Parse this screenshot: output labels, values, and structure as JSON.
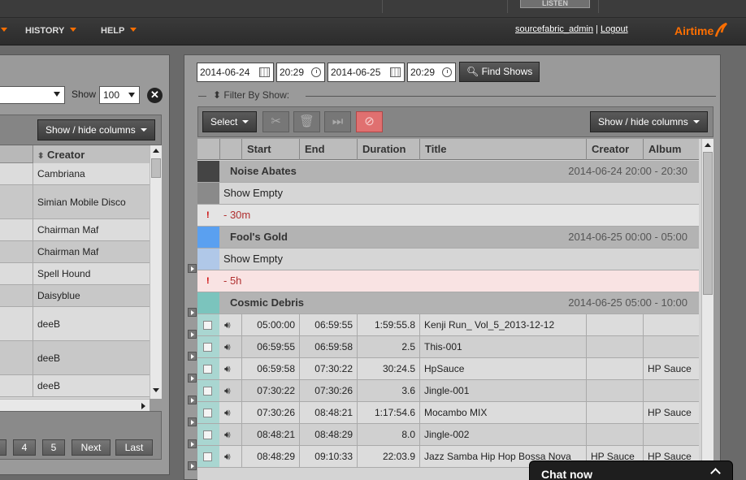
{
  "topbar": {
    "listen_label": "LISTEN"
  },
  "nav": {
    "history": "HISTORY",
    "help": "HELP",
    "user": "sourcefabric_admin",
    "separator": "|",
    "logout": "Logout",
    "logo": "Airtime",
    "accent": "#ff6f00"
  },
  "library": {
    "show_label": "Show",
    "show_value": "100",
    "close_icon": "close-icon",
    "columns_button": "Show / hide columns",
    "creator_header": "Creator",
    "rows": [
      "Cambriana",
      "Simian Mobile Disco",
      "Chairman Maf",
      "Chairman Maf",
      "Spell Hound",
      "Daisyblue",
      "deeB",
      "deeB",
      "deeB"
    ],
    "pager": [
      "4",
      "5",
      "Next",
      "Last"
    ]
  },
  "schedule": {
    "from_date": "2014-06-24",
    "from_time": "20:29",
    "to_date": "2014-06-25",
    "to_time": "20:29",
    "find_button": "Find Shows",
    "filter_label": "Filter By Show:",
    "select_button": "Select",
    "columns_button": "Show / hide columns",
    "headers": {
      "start": "Start",
      "end": "End",
      "duration": "Duration",
      "title": "Title",
      "creator": "Creator",
      "album": "Album"
    },
    "shows": [
      {
        "name": "Noise Abates",
        "time": "2014-06-24  20:00 - 20:30",
        "color": "#444444",
        "empty_label": "Show Empty",
        "empty_color": "#8a8a8a",
        "warn": "- 30m",
        "warn_mark": "!"
      },
      {
        "name": "Fool's Gold",
        "time": "2014-06-25  00:00 - 05:00",
        "color": "#5aa0f0",
        "empty_label": "Show Empty",
        "empty_color": "#b0c8e8",
        "warn": "- 5h",
        "warn_mark": "!"
      },
      {
        "name": "Cosmic Debris",
        "time": "2014-06-25  05:00 - 10:00",
        "color": "#7bc4bd"
      }
    ],
    "tracks": [
      {
        "start": "05:00:00",
        "end": "06:59:55",
        "duration": "1:59:55.8",
        "title": "Kenji Run_ Vol_5_2013-12-12",
        "creator": "",
        "album": ""
      },
      {
        "start": "06:59:55",
        "end": "06:59:58",
        "duration": "2.5",
        "title": "This-001",
        "creator": "",
        "album": ""
      },
      {
        "start": "06:59:58",
        "end": "07:30:22",
        "duration": "30:24.5",
        "title": "HpSauce",
        "creator": "",
        "album": "HP Sauce"
      },
      {
        "start": "07:30:22",
        "end": "07:30:26",
        "duration": "3.6",
        "title": "Jingle-001",
        "creator": "",
        "album": ""
      },
      {
        "start": "07:30:26",
        "end": "08:48:21",
        "duration": "1:17:54.6",
        "title": "Mocambo MIX",
        "creator": "",
        "album": "HP Sauce"
      },
      {
        "start": "08:48:21",
        "end": "08:48:29",
        "duration": "8.0",
        "title": "Jingle-002",
        "creator": "",
        "album": ""
      },
      {
        "start": "08:48:29",
        "end": "09:10:33",
        "duration": "22:03.9",
        "title": "Jazz Samba Hip Hop Bossa Nova",
        "creator": "HP Sauce",
        "album": "HP Sauce"
      }
    ]
  },
  "chat": {
    "label": "Chat now"
  }
}
